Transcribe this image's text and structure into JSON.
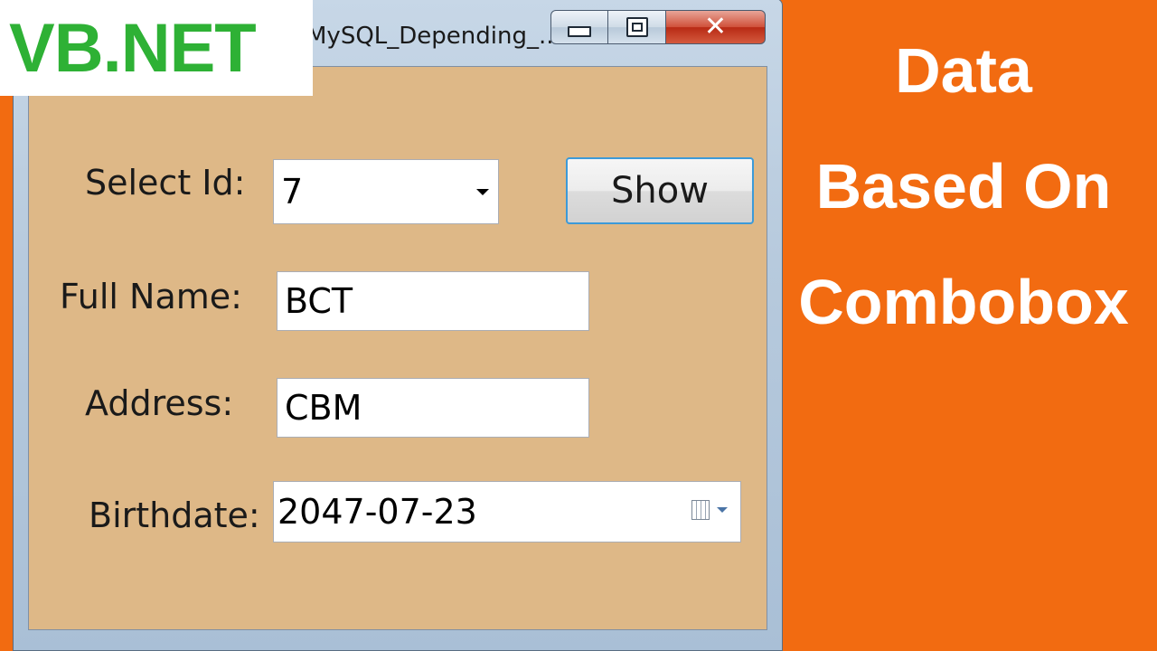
{
  "window": {
    "title": "MySQL_Depending_...",
    "caption_buttons": {
      "minimize": "minimize-icon",
      "maximize": "maximize-icon",
      "close": "close-icon"
    }
  },
  "form": {
    "select_id_label": "Select Id:",
    "select_id_value": "7",
    "show_button": "Show",
    "full_name_label": "Full Name:",
    "full_name_value": "BCT",
    "address_label": "Address:",
    "address_value": "CBM",
    "birthdate_label": "Birthdate:",
    "birthdate_value": "2047-07-23"
  },
  "overlay": {
    "brand": "VB.NET",
    "headline_line1": "Data",
    "headline_line2": "Based On",
    "headline_line3": "Combobox"
  },
  "colors": {
    "background_orange": "#f26b11",
    "form_background": "#deb887",
    "brand_green": "#2eb135"
  }
}
